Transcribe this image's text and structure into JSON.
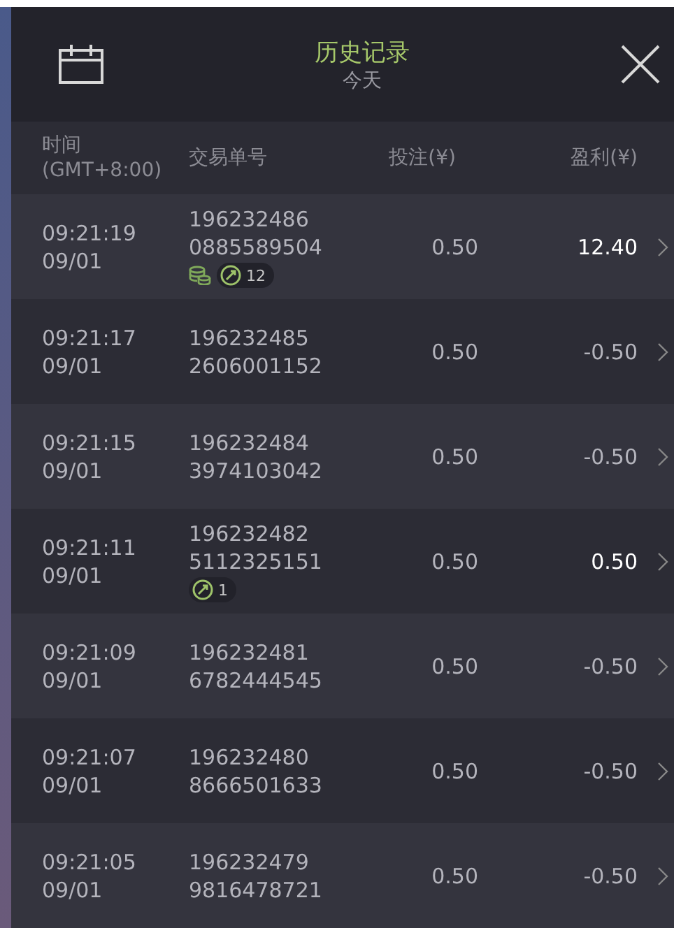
{
  "header": {
    "title": "历史记录",
    "subtitle": "今天"
  },
  "columns": [
    "时间\n(GMT+8:00)",
    "交易单号",
    "投注(¥)",
    "盈利(¥)"
  ],
  "rows": [
    {
      "time": "09:21:19",
      "date": "09/01",
      "id_1": "196232486",
      "id_2": "0885589504",
      "stake": "0.50",
      "profit": "12.40",
      "positive": true,
      "badges": [
        {
          "kind": "coins"
        },
        {
          "kind": "spins",
          "count": "12"
        }
      ]
    },
    {
      "time": "09:21:17",
      "date": "09/01",
      "id_1": "196232485",
      "id_2": "2606001152",
      "stake": "0.50",
      "profit": "-0.50",
      "positive": false,
      "badges": []
    },
    {
      "time": "09:21:15",
      "date": "09/01",
      "id_1": "196232484",
      "id_2": "3974103042",
      "stake": "0.50",
      "profit": "-0.50",
      "positive": false,
      "badges": []
    },
    {
      "time": "09:21:11",
      "date": "09/01",
      "id_1": "196232482",
      "id_2": "5112325151",
      "stake": "0.50",
      "profit": "0.50",
      "positive": true,
      "badges": [
        {
          "kind": "spins",
          "count": "1"
        }
      ]
    },
    {
      "time": "09:21:09",
      "date": "09/01",
      "id_1": "196232481",
      "id_2": "6782444545",
      "stake": "0.50",
      "profit": "-0.50",
      "positive": false,
      "badges": []
    },
    {
      "time": "09:21:07",
      "date": "09/01",
      "id_1": "196232480",
      "id_2": "8666501633",
      "stake": "0.50",
      "profit": "-0.50",
      "positive": false,
      "badges": []
    },
    {
      "time": "09:21:05",
      "date": "09/01",
      "id_1": "196232479",
      "id_2": "9816478721",
      "stake": "0.50",
      "profit": "-0.50",
      "positive": false,
      "badges": []
    }
  ]
}
